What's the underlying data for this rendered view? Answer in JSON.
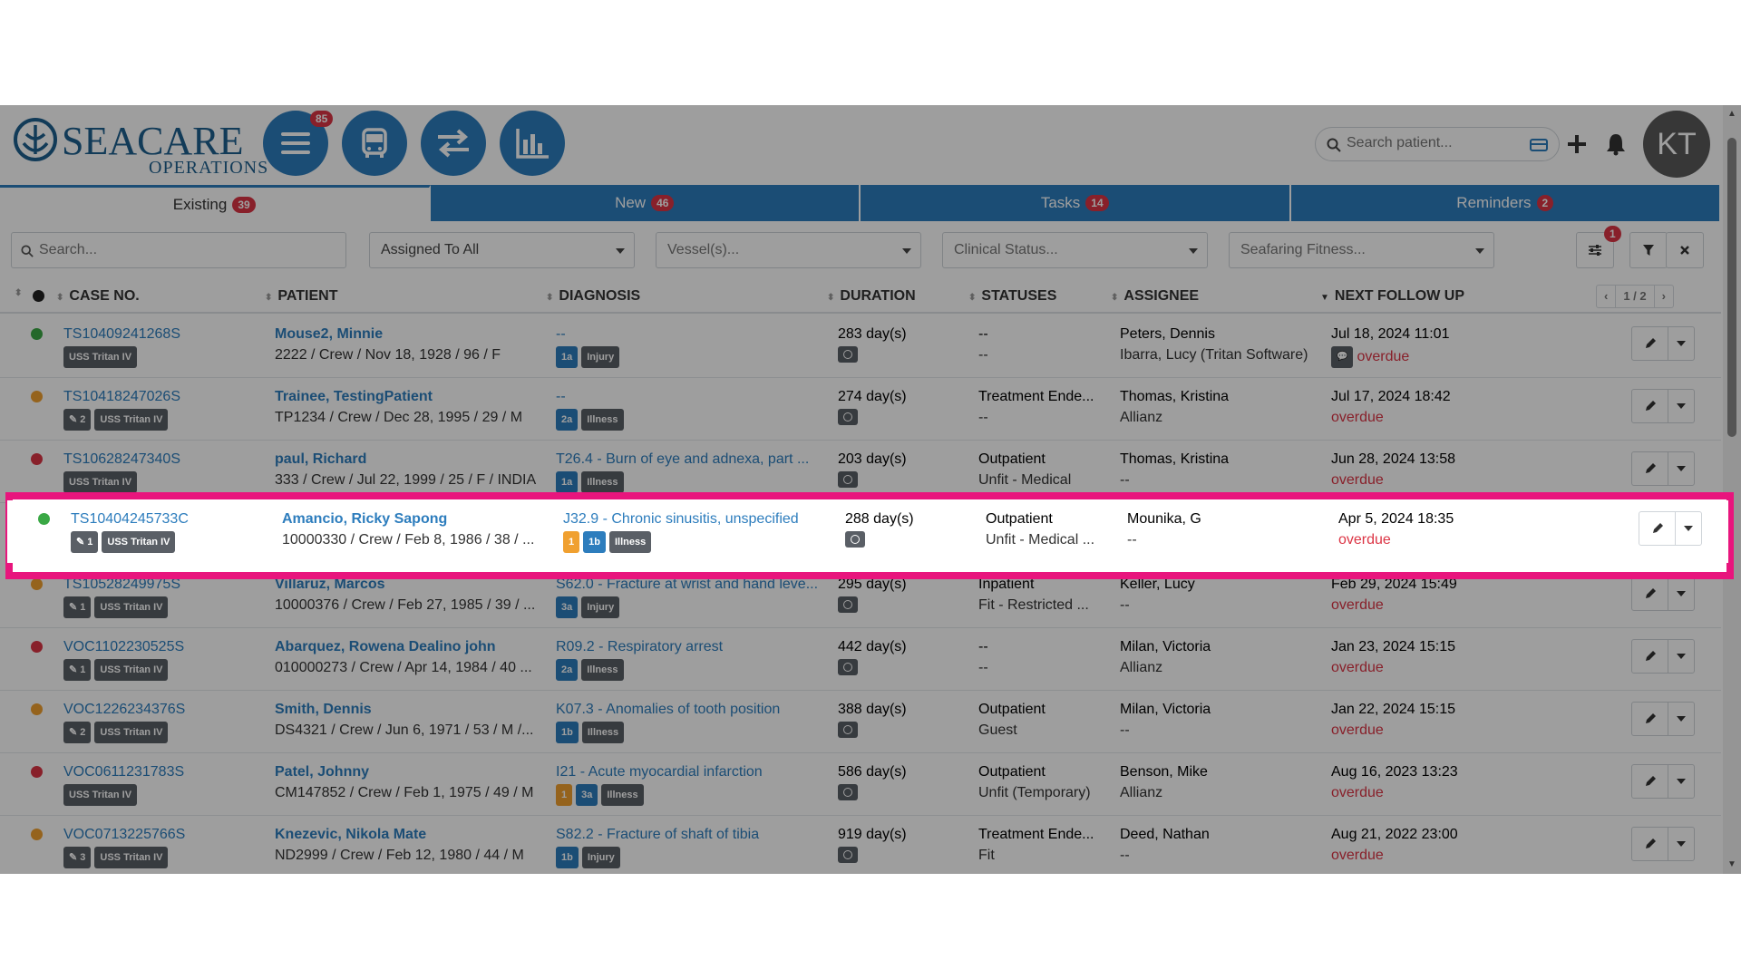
{
  "header": {
    "logo_name": "SEACARE",
    "logo_sub": "OPERATIONS",
    "menu_badge": "85",
    "search_placeholder": "Search patient...",
    "avatar_initials": "KT"
  },
  "tabs": [
    {
      "label": "Existing",
      "count": "39"
    },
    {
      "label": "New",
      "count": "46"
    },
    {
      "label": "Tasks",
      "count": "14"
    },
    {
      "label": "Reminders",
      "count": "2"
    }
  ],
  "filters": {
    "search_placeholder": "Search...",
    "assigned": "Assigned To All",
    "vessel": "Vessel(s)...",
    "clinical": "Clinical Status...",
    "fitness": "Seafaring Fitness...",
    "filter_badge": "1"
  },
  "columns": {
    "case": "CASE NO.",
    "patient": "PATIENT",
    "diagnosis": "DIAGNOSIS",
    "duration": "DURATION",
    "statuses": "STATUSES",
    "assignee": "ASSIGNEE",
    "followup": "NEXT FOLLOW UP"
  },
  "pager": {
    "prev": "‹",
    "page": "1 / 2",
    "next": "›"
  },
  "colors": {
    "green": "#3aa845",
    "orange": "#f0a030",
    "red": "#dc3545",
    "accent": "#2d7dbd",
    "highlight": "#e8157d"
  },
  "rows": [
    {
      "dot": "green",
      "case": "TS10409241268S",
      "attach": "",
      "vessel": "USS Tritan IV",
      "patient": "Mouse2, Minnie",
      "patient_info": "2222 / Crew / Nov 18, 1928 / 96 / F",
      "diagnosis": "--",
      "diag_link": false,
      "tags": [
        {
          "t": "1a",
          "c": "blue"
        },
        {
          "t": "Injury",
          "c": "dark"
        }
      ],
      "duration": "283 day(s)",
      "status1": "--",
      "status2": "--",
      "assignee1": "Peters, Dennis",
      "assignee2": "Ibarra, Lucy (Tritan Software)",
      "followup": "Jul 18, 2024 11:01",
      "overdue": "overdue",
      "chat": true
    },
    {
      "dot": "orange",
      "case": "TS10418247026S",
      "attach": "2",
      "vessel": "USS Tritan IV",
      "patient": "Trainee, TestingPatient",
      "patient_info": "TP1234 / Crew / Dec 28, 1995 / 29 / M",
      "diagnosis": "--",
      "diag_link": false,
      "tags": [
        {
          "t": "2a",
          "c": "blue"
        },
        {
          "t": "Illness",
          "c": "dark"
        }
      ],
      "duration": "274 day(s)",
      "status1": "Treatment Ende...",
      "status2": "--",
      "assignee1": "Thomas, Kristina",
      "assignee2": "Allianz",
      "followup": "Jul 17, 2024 18:42",
      "overdue": "overdue",
      "chat": false
    },
    {
      "dot": "red",
      "case": "TS10628247340S",
      "attach": "",
      "vessel": "USS Tritan IV",
      "patient": "paul, Richard",
      "patient_info": "333 / Crew / Jul 22, 1999 / 25 / F / INDIA",
      "diagnosis": "T26.4 - Burn of eye and adnexa, part ...",
      "diag_link": true,
      "tags": [
        {
          "t": "1a",
          "c": "blue"
        },
        {
          "t": "Illness",
          "c": "dark"
        }
      ],
      "duration": "203 day(s)",
      "status1": "Outpatient",
      "status2": "Unfit - Medical",
      "assignee1": "Thomas, Kristina",
      "assignee2": "--",
      "followup": "Jun 28, 2024 13:58",
      "overdue": "overdue",
      "chat": false
    },
    {
      "dot": "green",
      "case": "TS10404245733C",
      "attach": "1",
      "vessel": "USS Tritan IV",
      "patient": "Amancio, Ricky Sapong",
      "patient_info": "10000330 / Crew / Feb 8, 1986 / 38 / ...",
      "diagnosis": "J32.9 - Chronic sinusitis, unspecified",
      "diag_link": true,
      "tags": [
        {
          "t": "1",
          "c": "orange"
        },
        {
          "t": "1b",
          "c": "blue"
        },
        {
          "t": "Illness",
          "c": "dark"
        }
      ],
      "duration": "288 day(s)",
      "status1": "Outpatient",
      "status2": "Unfit - Medical ...",
      "assignee1": "Mounika, G",
      "assignee2": "--",
      "followup": "Apr 5, 2024 18:35",
      "overdue": "overdue",
      "chat": false
    },
    {
      "dot": "orange",
      "case": "TS10528249975S",
      "attach": "1",
      "vessel": "USS Tritan IV",
      "patient": "Villaruz, Marcos",
      "patient_info": "10000376 / Crew / Feb 27, 1985 / 39 / ...",
      "diagnosis": "S62.0 - Fracture at wrist and hand leve...",
      "diag_link": true,
      "tags": [
        {
          "t": "3a",
          "c": "blue"
        },
        {
          "t": "Injury",
          "c": "dark"
        }
      ],
      "duration": "295 day(s)",
      "status1": "Inpatient",
      "status2": "Fit - Restricted ...",
      "assignee1": "Keller, Lucy",
      "assignee2": "--",
      "followup": "Feb 29, 2024 15:49",
      "overdue": "overdue",
      "chat": false
    },
    {
      "dot": "red",
      "case": "VOC1102230525S",
      "attach": "1",
      "vessel": "USS Tritan IV",
      "patient": "Abarquez, Rowena Dealino john",
      "patient_info": "010000273 / Crew / Apr 14, 1984 / 40 ...",
      "diagnosis": "R09.2 - Respiratory arrest",
      "diag_link": true,
      "tags": [
        {
          "t": "2a",
          "c": "blue"
        },
        {
          "t": "Illness",
          "c": "dark"
        }
      ],
      "duration": "442 day(s)",
      "status1": "--",
      "status2": "--",
      "assignee1": "Milan, Victoria",
      "assignee2": "Allianz",
      "followup": "Jan 23, 2024 15:15",
      "overdue": "overdue",
      "chat": false
    },
    {
      "dot": "orange",
      "case": "VOC1226234376S",
      "attach": "2",
      "vessel": "USS Tritan IV",
      "patient": "Smith, Dennis",
      "patient_info": "DS4321 / Crew / Jun 6, 1971 / 53 / M /...",
      "diagnosis": "K07.3 - Anomalies of tooth position",
      "diag_link": true,
      "tags": [
        {
          "t": "1b",
          "c": "blue"
        },
        {
          "t": "Illness",
          "c": "dark"
        }
      ],
      "duration": "388 day(s)",
      "status1": "Outpatient",
      "status2": "Guest",
      "assignee1": "Milan, Victoria",
      "assignee2": "--",
      "followup": "Jan 22, 2024 15:15",
      "overdue": "overdue",
      "chat": false
    },
    {
      "dot": "red",
      "case": "VOC0611231783S",
      "attach": "",
      "vessel": "USS Tritan IV",
      "patient": "Patel, Johnny",
      "patient_info": "CM147852 / Crew / Feb 1, 1975 / 49 / M",
      "diagnosis": "I21 - Acute myocardial infarction",
      "diag_link": true,
      "tags": [
        {
          "t": "1",
          "c": "orange"
        },
        {
          "t": "3a",
          "c": "blue"
        },
        {
          "t": "Illness",
          "c": "dark"
        }
      ],
      "duration": "586 day(s)",
      "status1": "Outpatient",
      "status2": "Unfit (Temporary)",
      "assignee1": "Benson, Mike",
      "assignee2": "Allianz",
      "followup": "Aug 16, 2023 13:23",
      "overdue": "overdue",
      "chat": false
    },
    {
      "dot": "orange",
      "case": "VOC0713225766S",
      "attach": "3",
      "vessel": "USS Tritan IV",
      "patient": "Knezevic, Nikola Mate",
      "patient_info": "ND2999 / Crew / Feb 12, 1980 / 44 / M",
      "diagnosis": "S82.2 - Fracture of shaft of tibia",
      "diag_link": true,
      "tags": [
        {
          "t": "1b",
          "c": "blue"
        },
        {
          "t": "Injury",
          "c": "dark"
        }
      ],
      "duration": "919 day(s)",
      "status1": "Treatment Ende...",
      "status2": "Fit",
      "assignee1": "Deed, Nathan",
      "assignee2": "--",
      "followup": "Aug 21, 2022 23:00",
      "overdue": "overdue",
      "chat": false
    }
  ]
}
